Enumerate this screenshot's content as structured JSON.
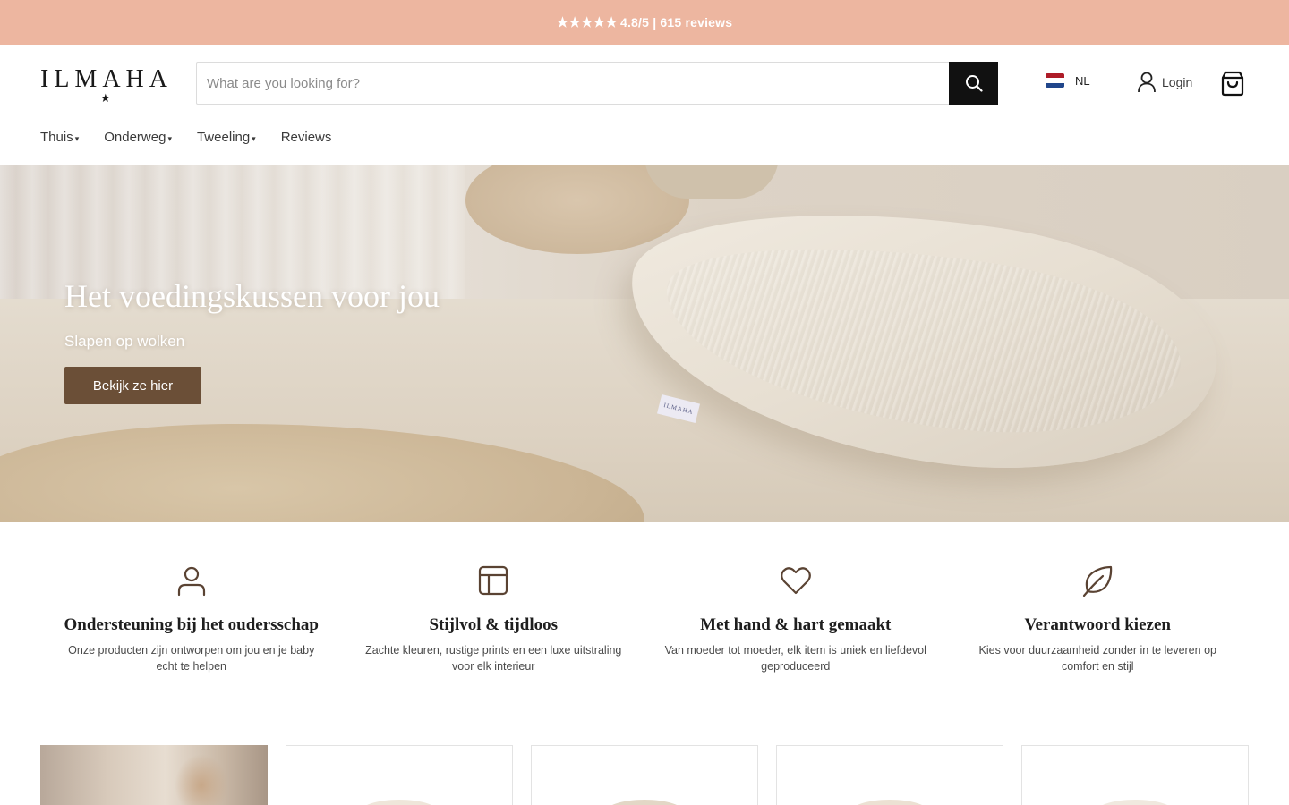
{
  "announcement": {
    "stars": "★★★★★",
    "rating_text": "4.8/5 | 615 reviews"
  },
  "header": {
    "logo_text": "ILMAHA",
    "logo_star": "★",
    "search_placeholder": "What are you looking for?",
    "language": "NL",
    "login_label": "Login"
  },
  "nav": {
    "items": [
      {
        "label": "Thuis",
        "has_dropdown": true
      },
      {
        "label": "Onderweg",
        "has_dropdown": true
      },
      {
        "label": "Tweeling",
        "has_dropdown": true
      },
      {
        "label": "Reviews",
        "has_dropdown": false
      }
    ],
    "chevron": "⌄"
  },
  "hero": {
    "title": "Het voedingskussen voor jou",
    "subtitle": "Slapen op wolken",
    "button_label": "Bekijk ze hier",
    "tag_text": "ILMAHA"
  },
  "features": [
    {
      "icon": "user-icon",
      "title": "Ondersteuning bij het oudersschap",
      "desc": "Onze producten zijn ontworpen om jou en je baby echt te helpen"
    },
    {
      "icon": "layout-icon",
      "title": "Stijlvol & tijdloos",
      "desc": "Zachte kleuren, rustige prints en een luxe uitstraling voor elk interieur"
    },
    {
      "icon": "heart-icon",
      "title": "Met hand & hart gemaakt",
      "desc": "Van moeder tot moeder, elk item is uniek en liefdevol geproduceerd"
    },
    {
      "icon": "leaf-icon",
      "title": "Verantwoord kiezen",
      "desc": "Kies voor duurzaamheid zonder in te leveren op comfort en stijl"
    }
  ],
  "colors": {
    "announcement_bg": "#edb6a0",
    "button_brown": "#6b4f37",
    "icon_brown": "#5a4333",
    "search_button": "#111111"
  }
}
